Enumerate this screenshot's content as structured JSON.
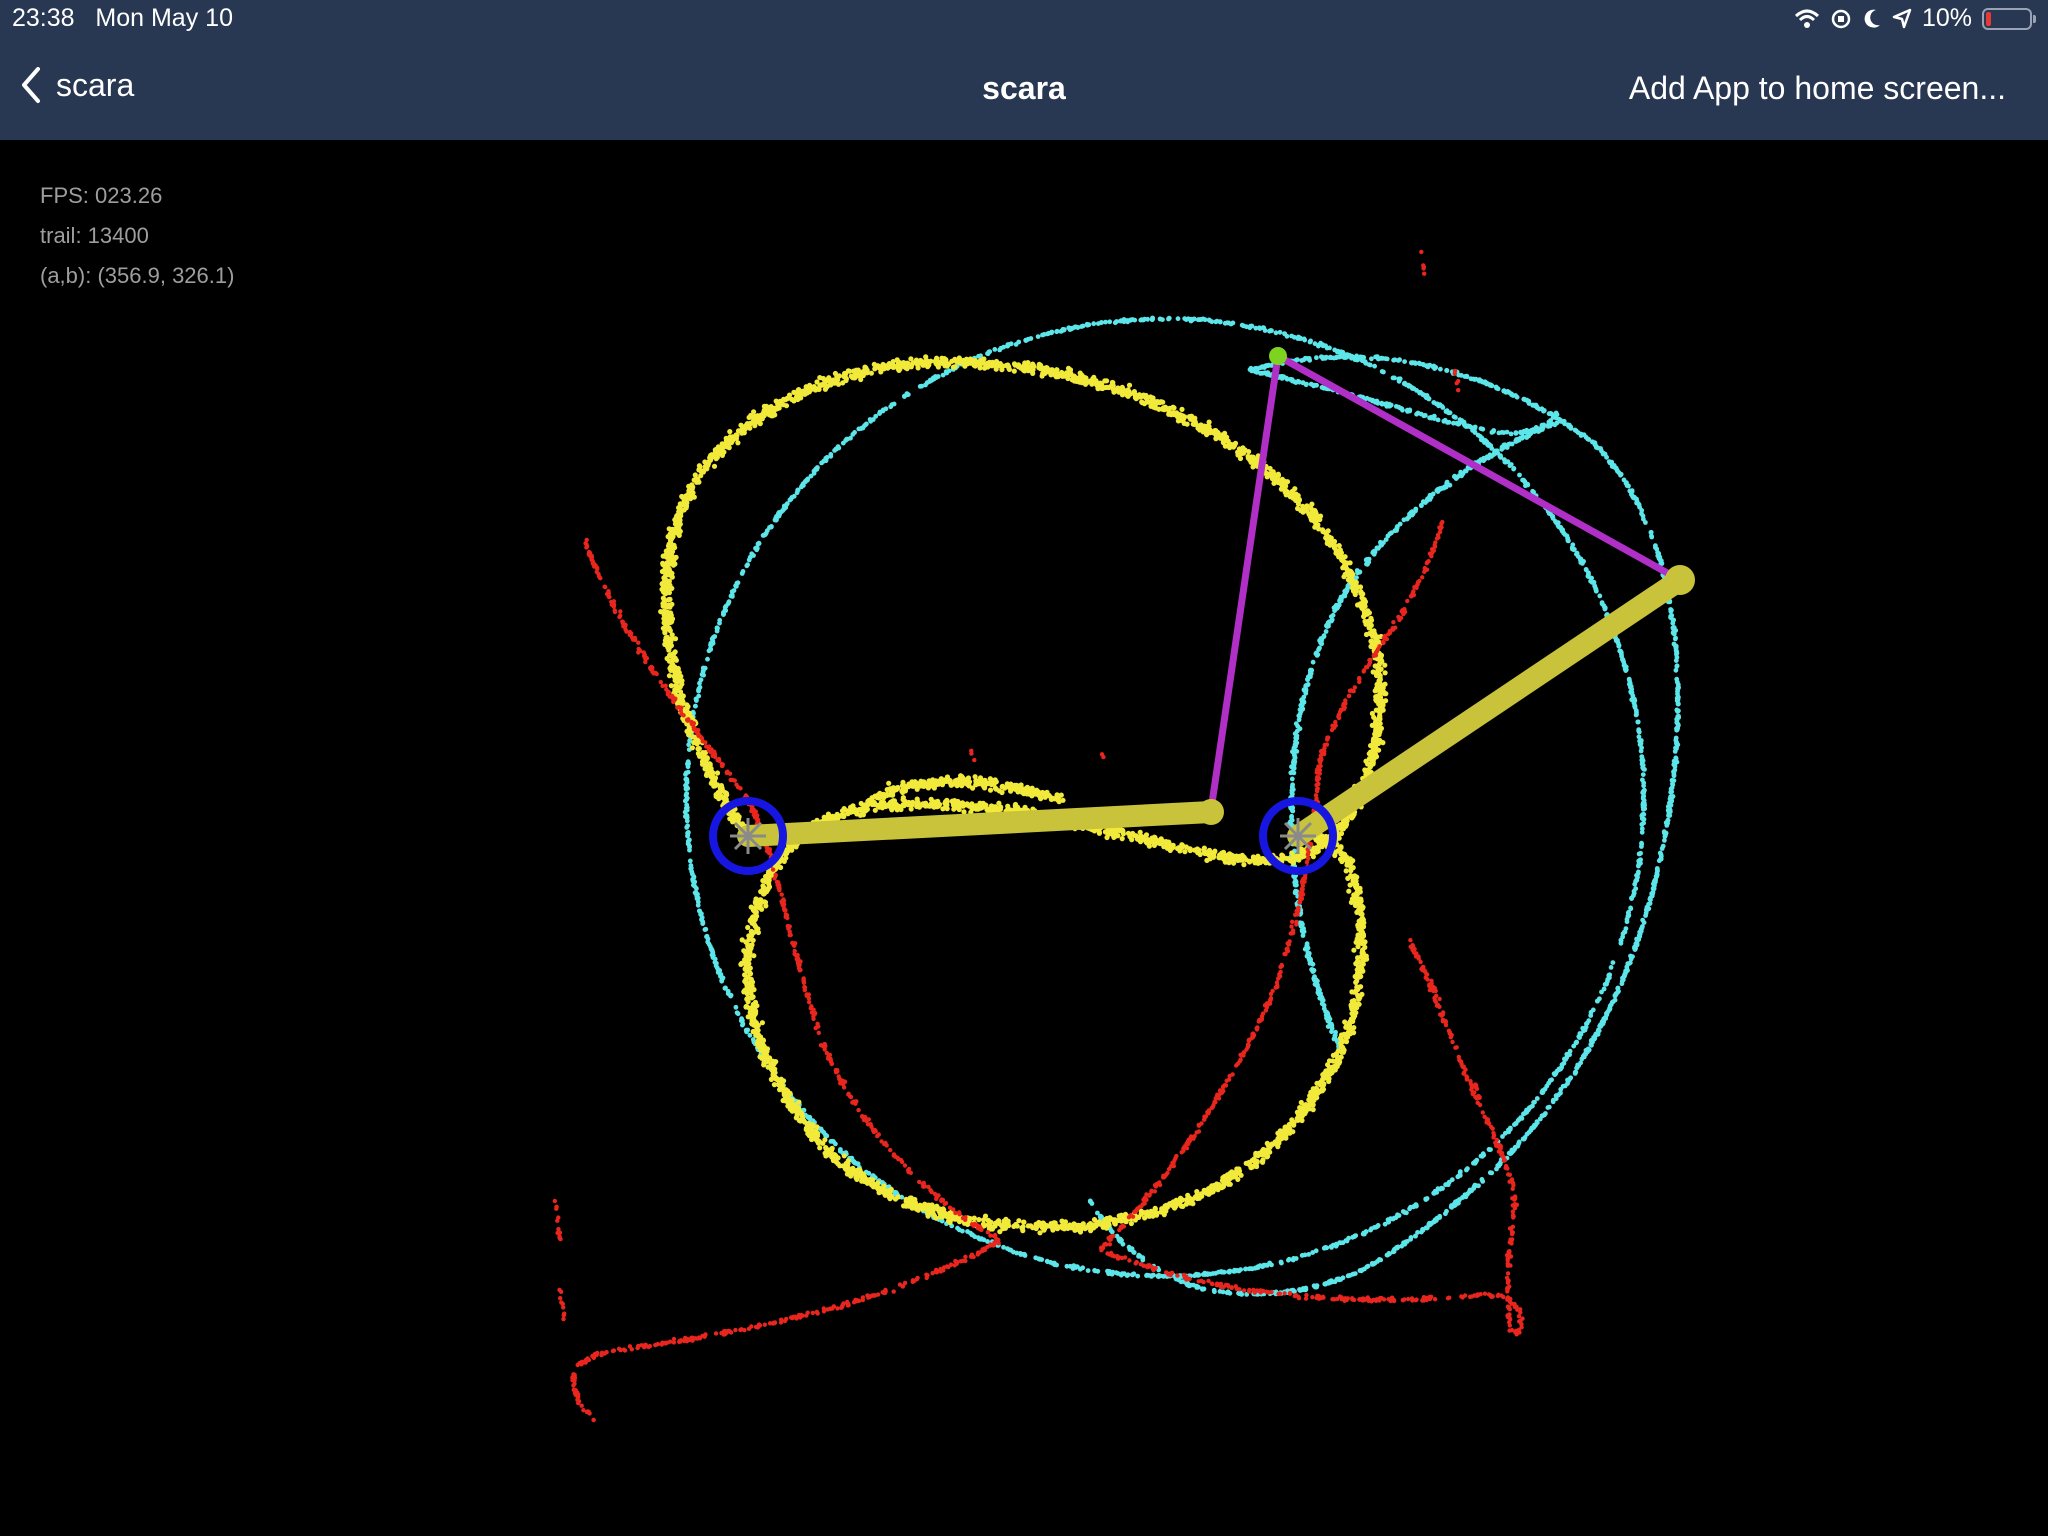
{
  "status_bar": {
    "time": "23:38",
    "date": "Mon May 10",
    "battery": "10%",
    "icons": [
      "wifi-icon",
      "orientation-lock-icon",
      "moon-icon",
      "location-icon",
      "battery-icon"
    ]
  },
  "nav": {
    "back_label": "scara",
    "title": "scara",
    "add_app_label": "Add App to home screen..."
  },
  "info": {
    "fps": "FPS: 023.26",
    "trail": "trail: 13400",
    "ab": "(a,b): (356.9, 326.1)"
  },
  "colors": {
    "header_bg": "#283752",
    "background": "#000000",
    "yellow_trail": "#f2ea3a",
    "cyan_circle": "#5ce6ea",
    "red_trail": "#e8261d",
    "arm": "#c8c33a",
    "linkage": "#b02fc6",
    "motor_ring": "#1616e0",
    "end_effector": "#7ed321"
  }
}
